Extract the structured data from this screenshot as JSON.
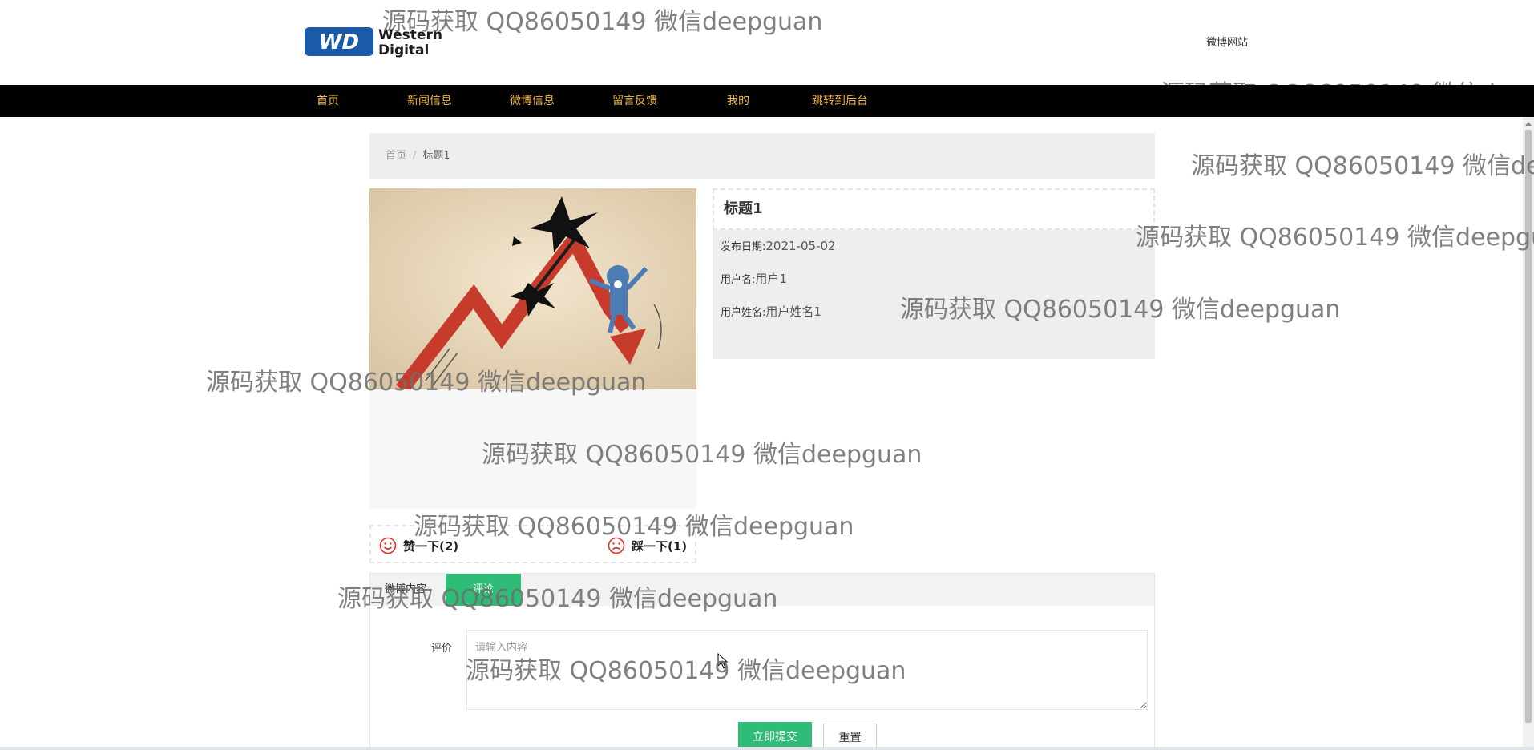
{
  "header": {
    "logo_text_line1": "Western",
    "logo_text_line2": "Digital",
    "logo_mark": "WD",
    "site_name": "微博网站"
  },
  "nav": {
    "items": [
      {
        "label": "首页"
      },
      {
        "label": "新闻信息"
      },
      {
        "label": "微博信息"
      },
      {
        "label": "留言反馈"
      },
      {
        "label": "我的"
      },
      {
        "label": "跳转到后台"
      }
    ]
  },
  "breadcrumb": {
    "home": "首页",
    "separator": "/",
    "current": "标题1"
  },
  "detail": {
    "title": "标题1",
    "publish_date_label": "发布日期:",
    "publish_date": "2021-05-02",
    "username_label": "用户名:",
    "username": "用户1",
    "realname_label": "用户姓名:",
    "realname": "用户姓名1"
  },
  "votes": {
    "like_label": "赞一下(2)",
    "like_icon": "smile-icon",
    "dislike_label": "踩一下(1)",
    "dislike_icon": "frown-icon"
  },
  "tabs": {
    "detail_label": "微博内容",
    "comment_label": "评论"
  },
  "comment_form": {
    "label": "评价",
    "placeholder": "请输入内容",
    "submit_label": "立即提交",
    "reset_label": "重置"
  },
  "watermark": {
    "text": "源码获取 QQ86050149 微信deepguan"
  },
  "colors": {
    "nav_bg": "#000000",
    "nav_text": "#f4b84a",
    "accent_green": "#2fbc77",
    "panel_gray": "#eeeeee",
    "vote_icon_red": "#e0302a"
  }
}
